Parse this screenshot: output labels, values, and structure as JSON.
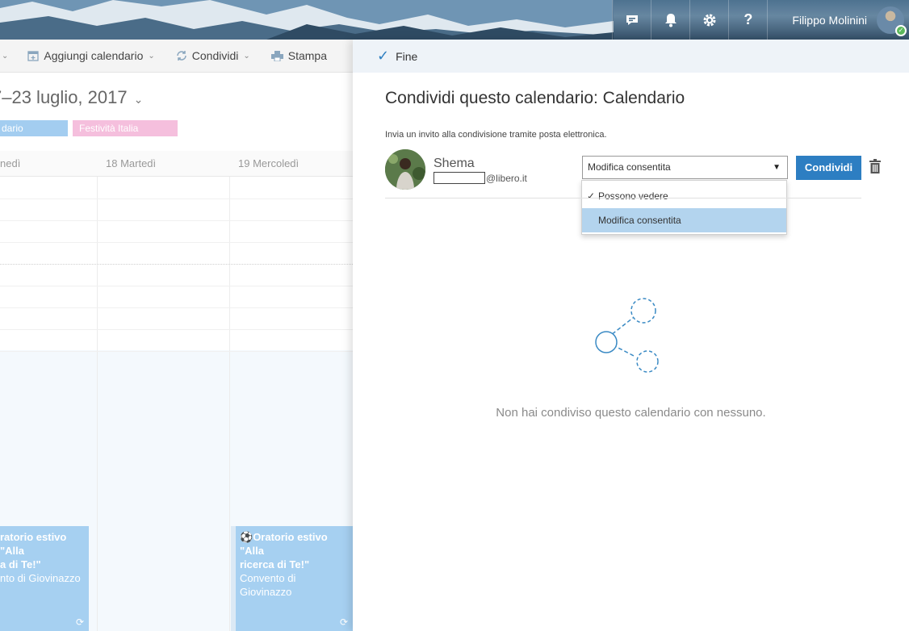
{
  "header": {
    "user_name": "Filippo Molinini",
    "icons": [
      "chat-icon",
      "bell-icon",
      "gear-icon",
      "help-icon"
    ]
  },
  "toolbar": {
    "add_calendar": "Aggiungi calendario",
    "share": "Condividi",
    "print": "Stampa"
  },
  "calendar": {
    "date_range": "7–23 luglio, 2017",
    "chip_calendar": "dario",
    "chip_holidays": "Festività Italia",
    "days": [
      "nedì",
      "18 Martedì",
      "19 Mercoledì"
    ],
    "event_left": {
      "title": "ratorio estivo \"Alla a di Te!\"",
      "title_line1": "ratorio estivo \"Alla",
      "title_line2": "a di Te!\"",
      "location": "nto di Giovinazzo"
    },
    "event_right": {
      "title_line1": "Oratorio estivo \"Alla",
      "title_line2": "ricerca di Te!\"",
      "location": "Convento di Giovinazzo"
    }
  },
  "share_panel": {
    "done_label": "Fine",
    "title": "Condividi questo calendario: Calendario",
    "invite_text": "Invia un invito alla condivisione tramite posta elettronica.",
    "contact_name": "Shema",
    "contact_email_domain": "@libero.it",
    "permission_selected": "Modifica consentita",
    "permission_options": [
      "Possono vedere",
      "Modifica consentita"
    ],
    "share_button": "Condividi",
    "empty_message": "Non hai condiviso questo calendario con nessuno."
  },
  "colors": {
    "accent": "#2d7ec2",
    "event_blue": "#a6d0f1",
    "holiday_pink": "#f5bfdd",
    "dropdown_highlight": "#b3d4ee"
  }
}
